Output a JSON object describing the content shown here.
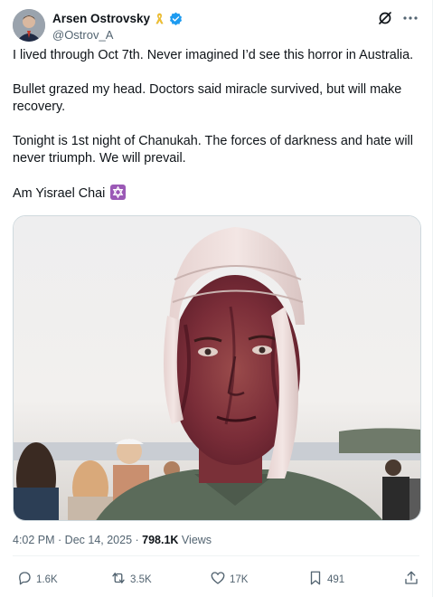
{
  "author": {
    "display_name": "Arsen Ostrovsky",
    "handle": "@Ostrov_A",
    "avatar_icon": "profile-photo",
    "badges": [
      "yellow-ribbon-icon",
      "verified-badge-icon"
    ]
  },
  "header_actions": [
    "grok-icon",
    "more-icon"
  ],
  "body": {
    "para1": "I lived through Oct 7th. Never imagined I’d see this horror in Australia.",
    "para2": "Bullet grazed my head. Doctors said miracle survived, but will make recovery.",
    "para3": "Tonight is 1st night of Chanukah. The forces of darkness and hate will never triumph. We will prevail.",
    "para4": "Am Yisrael Chai",
    "para4_emoji": "star-of-david-icon"
  },
  "media": {
    "type": "photo"
  },
  "meta": {
    "time": "4:02 PM",
    "separator": " · ",
    "date": "Dec 14, 2025",
    "views_count": "798.1K",
    "views_label": " Views"
  },
  "actions": {
    "reply_count": "1.6K",
    "repost_count": "3.5K",
    "like_count": "17K",
    "bookmark_count": "491"
  },
  "colors": {
    "text": "#0f1419",
    "secondary": "#536471",
    "verified": "#1d9bf0",
    "ribbon": "#f4c430",
    "star_bg": "#9b59b6"
  }
}
